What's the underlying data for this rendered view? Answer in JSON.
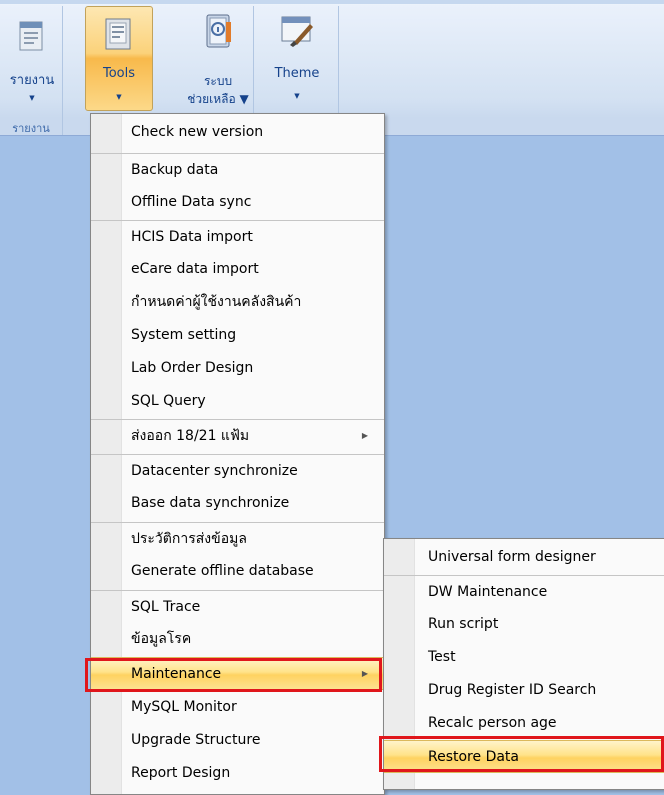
{
  "ribbon": {
    "report": {
      "label": "รายงาน",
      "arrow": "▼"
    },
    "tools": {
      "label": "Tools",
      "arrow": "▼"
    },
    "help": {
      "label": "ระบบ",
      "label2": "ช่วยเหลือ ▼"
    },
    "theme": {
      "label": "Theme",
      "arrow": "▼"
    },
    "group_label": "รายงาน"
  },
  "tools_menu": {
    "items": [
      {
        "label": "Check new version"
      },
      {
        "label": "Backup data"
      },
      {
        "label": "Offline Data sync"
      },
      {
        "label": "HCIS Data import"
      },
      {
        "label": "eCare data import"
      },
      {
        "label": "กำหนดค่าผู้ใช้งานคลังสินค้า"
      },
      {
        "label": "System setting"
      },
      {
        "label": "Lab Order Design"
      },
      {
        "label": "SQL Query"
      },
      {
        "label": "ส่งออก 18/21 แฟ้ม",
        "submenu_arrow": "▶"
      },
      {
        "label": "Datacenter synchronize"
      },
      {
        "label": "Base data synchronize"
      },
      {
        "label": "ประวัติการส่งข้อมูล"
      },
      {
        "label": "Generate offline database"
      },
      {
        "label": "SQL Trace"
      },
      {
        "label": "ข้อมูลโรค"
      },
      {
        "label": "Maintenance",
        "submenu_arrow": "▶"
      },
      {
        "label": "MySQL Monitor"
      },
      {
        "label": "Upgrade Structure"
      },
      {
        "label": "Report Design"
      }
    ]
  },
  "maintenance_menu": {
    "items": [
      {
        "label": "Universal form designer"
      },
      {
        "label": "DW Maintenance"
      },
      {
        "label": "Run script"
      },
      {
        "label": "Test"
      },
      {
        "label": "Drug Register ID Search"
      },
      {
        "label": "Recalc person age"
      },
      {
        "label": "Restore Data"
      }
    ]
  },
  "colors": {
    "highlight": "#fed261",
    "annotation_red": "#e0161b",
    "desktop_blue": "#a2c0e7"
  }
}
